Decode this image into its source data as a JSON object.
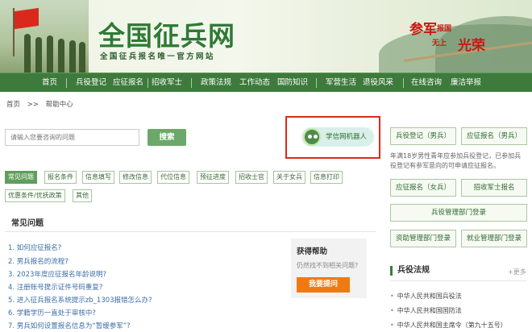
{
  "header": {
    "site_title": "全国征兵网",
    "site_subtitle": "全国征兵报名唯一官方网站",
    "slogan": [
      "参军",
      "报国",
      "无上",
      "光荣"
    ]
  },
  "nav": {
    "items": [
      "首页",
      "兵役登记",
      "应征报名",
      "招收军士",
      "政策法规",
      "工作动态",
      "国防知识",
      "军营生活",
      "退役风采",
      "在线咨询",
      "廉洁举报"
    ]
  },
  "breadcrumb": [
    "首页",
    ">>",
    "帮助中心"
  ],
  "search": {
    "placeholder": "请输入您要咨询的问题",
    "button": "搜索"
  },
  "robot": {
    "label": "学信网机器人"
  },
  "tags": [
    "常见问题",
    "报名条件",
    "信息填写",
    "修改信息",
    "代位信息",
    "预征进度",
    "招收士官",
    "关于女兵",
    "信息打印",
    "优惠条件/优抚政策",
    "其他"
  ],
  "faq": {
    "title": "常见问题",
    "questions": [
      "1. 如何应征报名?",
      "2. 男兵报名的流程?",
      "3. 2023年度应征报名年龄说明?",
      "4. 注册账号提示证件号码重复?",
      "5. 进入征兵报名系统提示zb_1303报错怎么办?",
      "6. 学籍学历一直处于审核中?",
      "7. 男兵如何设置报名信息为“暂缓参军”?"
    ]
  },
  "help": {
    "title": "获得帮助",
    "subtitle": "仍然找不到相关问题?",
    "button": "我要提问"
  },
  "right": {
    "btn_male_register": "兵役登记（男兵）",
    "btn_male_apply": "应征报名（男兵）",
    "note": "年满18岁男性青年应参加兵役登记，已参加兵役登记有参军意向的可申请应征报名。",
    "btn_female_apply": "应征报名（女兵）",
    "btn_nco": "招收军士报名",
    "btn_dept_login": "兵役管理部门登录",
    "btn_funding_login": "资助管理部门登录",
    "btn_employment_login": "就业管理部门登录",
    "laws_title": "兵役法规",
    "laws_more": "+更多",
    "laws": [
      "中华人民共和国兵役法",
      "中华人民共和国国防法",
      "中华人民共和国主席令（第九十五号）"
    ]
  },
  "colors": {
    "nav_green": "#3d7a3c",
    "title_green": "#2f7a35",
    "highlight_red": "#e0281e",
    "ask_orange": "#f07a12"
  }
}
